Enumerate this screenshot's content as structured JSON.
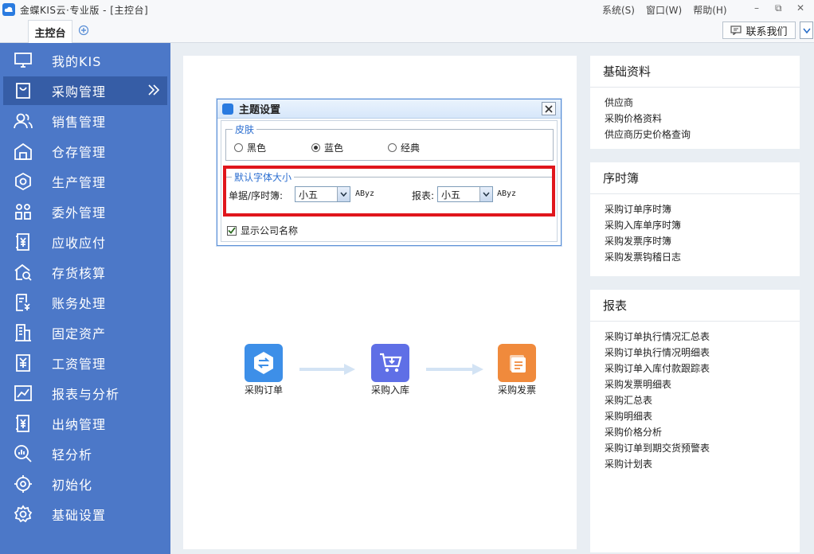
{
  "window": {
    "title": "金蝶KIS云·专业版 - [主控台]",
    "menus": [
      "系统(S)",
      "窗口(W)",
      "帮助(H)"
    ]
  },
  "tabs": {
    "main_tab": "主控台"
  },
  "contact_button": "联系我们",
  "sidebar": {
    "items": [
      {
        "label": "我的KIS",
        "icon": "monitor-icon"
      },
      {
        "label": "采购管理",
        "icon": "bag-icon"
      },
      {
        "label": "销售管理",
        "icon": "users-icon"
      },
      {
        "label": "仓存管理",
        "icon": "warehouse-icon"
      },
      {
        "label": "生产管理",
        "icon": "hexagon-icon"
      },
      {
        "label": "委外管理",
        "icon": "outsourcing-icon"
      },
      {
        "label": "应收应付",
        "icon": "yen-document-icon"
      },
      {
        "label": "存货核算",
        "icon": "house-search-icon"
      },
      {
        "label": "账务处理",
        "icon": "ledger-icon"
      },
      {
        "label": "固定资产",
        "icon": "building-icon"
      },
      {
        "label": "工资管理",
        "icon": "salary-icon"
      },
      {
        "label": "报表与分析",
        "icon": "line-chart-icon"
      },
      {
        "label": "出纳管理",
        "icon": "cashier-icon"
      },
      {
        "label": "轻分析",
        "icon": "magnifier-chart-icon"
      },
      {
        "label": "初始化",
        "icon": "target-icon"
      },
      {
        "label": "基础设置",
        "icon": "gear-icon"
      }
    ],
    "active_index": 1
  },
  "dialog": {
    "title": "主题设置",
    "skin": {
      "legend": "皮肤",
      "options": [
        "黑色",
        "蓝色",
        "经典"
      ],
      "selected": "蓝色"
    },
    "font": {
      "legend": "默认字体大小",
      "doc_label": "单据/序时簿:",
      "doc_value": "小五",
      "report_label": "报表:",
      "report_value": "小五",
      "sample": "AByz"
    },
    "show_company": {
      "label": "显示公司名称",
      "checked": true
    }
  },
  "flow": {
    "nodes": [
      {
        "label": "采购订单",
        "color": "#3d8fe8"
      },
      {
        "label": "采购入库",
        "color": "#5f6fe6"
      },
      {
        "label": "采购发票",
        "color": "#f08a3c"
      }
    ]
  },
  "cards": {
    "basic": {
      "title": "基础资料",
      "links": [
        "供应商",
        "采购价格资料",
        "供应商历史价格查询"
      ]
    },
    "journal": {
      "title": "序时簿",
      "links": [
        "采购订单序时簿",
        "采购入库单序时簿",
        "采购发票序时簿",
        "采购发票钩稽日志"
      ]
    },
    "report": {
      "title": "报表",
      "links": [
        "采购订单执行情况汇总表",
        "采购订单执行情况明细表",
        "采购订单入库付款跟踪表",
        "采购发票明细表",
        "采购汇总表",
        "采购明细表",
        "采购价格分析",
        "采购订单到期交货预警表",
        "采购计划表"
      ]
    }
  }
}
